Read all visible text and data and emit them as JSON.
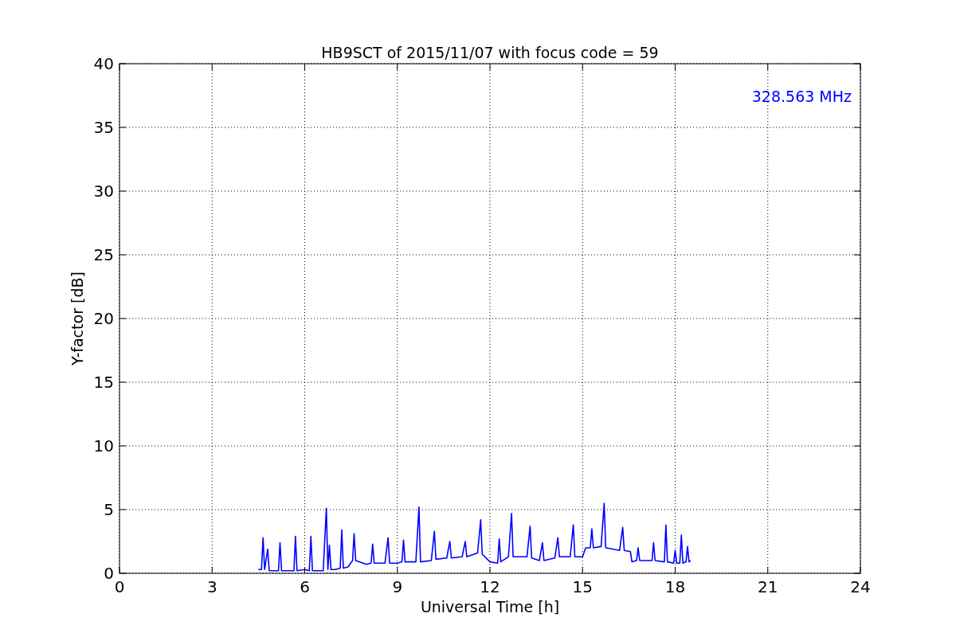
{
  "chart_data": {
    "type": "line",
    "title": "HB9SCT of 2015/11/07 with focus code = 59",
    "xlabel": "Universal Time [h]",
    "ylabel": "Y-factor [dB]",
    "xlim": [
      0,
      24
    ],
    "ylim": [
      0,
      40
    ],
    "xticks": [
      0,
      3,
      6,
      9,
      12,
      15,
      18,
      21,
      24
    ],
    "yticks": [
      0,
      5,
      10,
      15,
      20,
      25,
      30,
      35,
      40
    ],
    "x": [
      4.5,
      4.6,
      4.65,
      4.7,
      4.8,
      4.85,
      5.0,
      5.15,
      5.2,
      5.25,
      5.5,
      5.65,
      5.7,
      5.75,
      6.0,
      6.15,
      6.2,
      6.25,
      6.6,
      6.7,
      6.75,
      6.8,
      6.85,
      7.0,
      7.15,
      7.2,
      7.25,
      7.4,
      7.55,
      7.6,
      7.65,
      8.0,
      8.15,
      8.2,
      8.25,
      8.6,
      8.7,
      8.75,
      9.0,
      9.15,
      9.2,
      9.25,
      9.6,
      9.7,
      9.75,
      10.1,
      10.2,
      10.25,
      10.6,
      10.7,
      10.75,
      11.1,
      11.2,
      11.25,
      11.6,
      11.7,
      11.75,
      12.0,
      12.25,
      12.3,
      12.35,
      12.6,
      12.7,
      12.75,
      13.2,
      13.3,
      13.35,
      13.6,
      13.7,
      13.75,
      14.1,
      14.2,
      14.25,
      14.6,
      14.7,
      14.75,
      15.0,
      15.1,
      15.25,
      15.3,
      15.35,
      15.6,
      15.7,
      15.75,
      16.2,
      16.3,
      16.35,
      16.55,
      16.6,
      16.75,
      16.8,
      16.85,
      17.25,
      17.3,
      17.35,
      17.65,
      17.7,
      17.75,
      17.95,
      18.0,
      18.05,
      18.15,
      18.2,
      18.25,
      18.35,
      18.4,
      18.45,
      18.5
    ],
    "series": [
      {
        "color": "#0000ff",
        "values": [
          0.3,
          0.3,
          2.8,
          0.3,
          1.9,
          0.2,
          0.2,
          0.2,
          2.4,
          0.2,
          0.2,
          0.2,
          2.9,
          0.2,
          0.3,
          0.2,
          2.9,
          0.2,
          0.2,
          5.1,
          0.3,
          2.2,
          0.3,
          0.3,
          0.4,
          3.4,
          0.4,
          0.5,
          1.0,
          3.1,
          1.0,
          0.7,
          0.8,
          2.3,
          0.8,
          0.8,
          2.8,
          0.8,
          0.8,
          0.9,
          2.6,
          0.9,
          0.9,
          5.2,
          0.9,
          1.0,
          3.3,
          1.1,
          1.2,
          2.5,
          1.2,
          1.3,
          2.5,
          1.3,
          1.6,
          4.2,
          1.5,
          0.9,
          0.8,
          2.7,
          0.9,
          1.3,
          4.7,
          1.3,
          1.3,
          3.7,
          1.2,
          1.0,
          2.4,
          1.0,
          1.2,
          2.8,
          1.3,
          1.3,
          3.8,
          1.3,
          1.3,
          2.0,
          2.0,
          3.5,
          2.0,
          2.1,
          5.5,
          2.0,
          1.8,
          3.6,
          1.8,
          1.7,
          0.9,
          1.0,
          2.0,
          1.0,
          1.0,
          2.4,
          1.0,
          0.9,
          3.8,
          0.9,
          0.8,
          1.8,
          0.8,
          0.8,
          3.0,
          0.8,
          0.9,
          2.1,
          0.9,
          1.0
        ]
      }
    ],
    "grid": true,
    "annotations": [
      {
        "text": "328.563 MHz"
      }
    ]
  }
}
